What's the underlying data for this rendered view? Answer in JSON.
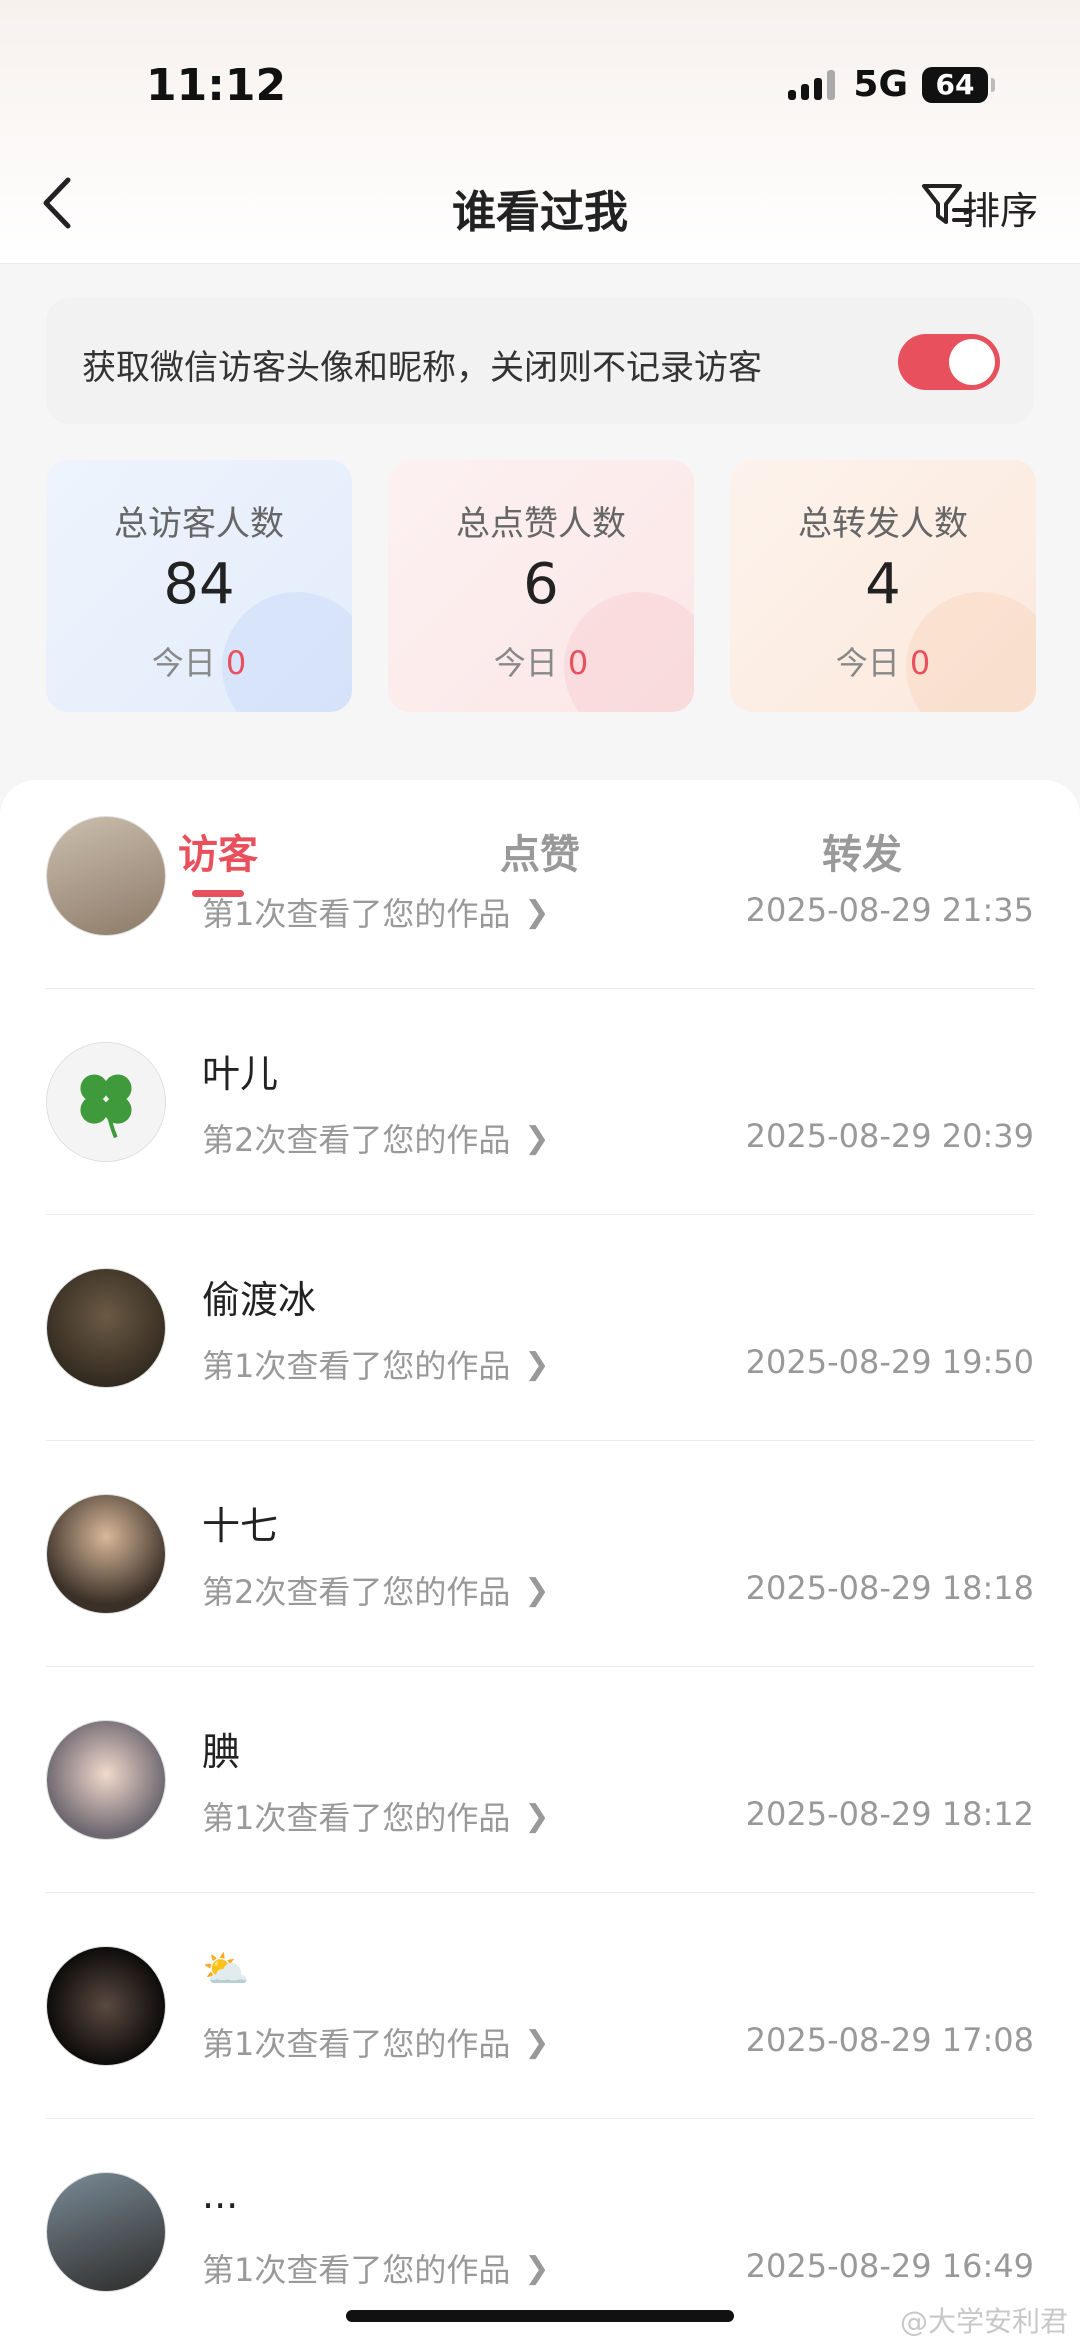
{
  "status_bar": {
    "time": "11:12",
    "network": "5G",
    "battery": "64"
  },
  "header": {
    "title": "谁看过我",
    "sort_label": "排序"
  },
  "notice": {
    "text": "获取微信访客头像和昵称，关闭则不记录访客",
    "toggle_on": true
  },
  "stats": [
    {
      "label": "总访客人数",
      "value": "84",
      "today_label": "今日",
      "today_value": "0"
    },
    {
      "label": "总点赞人数",
      "value": "6",
      "today_label": "今日",
      "today_value": "0"
    },
    {
      "label": "总转发人数",
      "value": "4",
      "today_label": "今日",
      "today_value": "0"
    }
  ],
  "tabs": [
    {
      "label": "访客",
      "active": true
    },
    {
      "label": "点赞",
      "active": false
    },
    {
      "label": "转发",
      "active": false
    }
  ],
  "visitors": [
    {
      "name": "",
      "desc": "第1次查看了您的作品",
      "time": "2025-08-29 21:35"
    },
    {
      "name": "叶儿",
      "desc": "第2次查看了您的作品",
      "time": "2025-08-29 20:39"
    },
    {
      "name": "偷渡冰",
      "desc": "第1次查看了您的作品",
      "time": "2025-08-29 19:50"
    },
    {
      "name": "十七",
      "desc": "第2次查看了您的作品",
      "time": "2025-08-29 18:18"
    },
    {
      "name": "腆",
      "desc": "第1次查看了您的作品",
      "time": "2025-08-29 18:12"
    },
    {
      "name": "⛅",
      "desc": "第1次查看了您的作品",
      "time": "2025-08-29 17:08"
    },
    {
      "name": "...",
      "desc": "第1次查看了您的作品",
      "time": "2025-08-29 16:49"
    }
  ],
  "watermark": "@大学安利君",
  "colors": {
    "accent": "#e8505e"
  }
}
